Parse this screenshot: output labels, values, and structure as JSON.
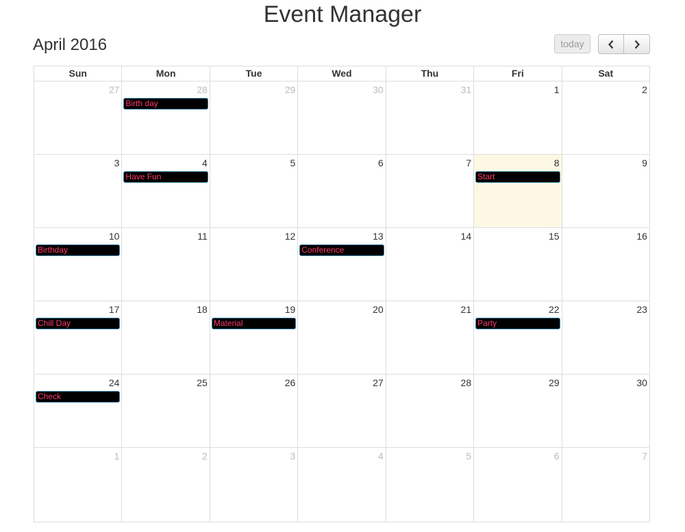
{
  "app": {
    "title": "Event Manager"
  },
  "toolbar": {
    "month_title": "April 2016",
    "today_label": "today",
    "prev_icon": "chevron-left-icon",
    "next_icon": "chevron-right-icon"
  },
  "colors": {
    "event_bg": "#000000",
    "event_text": "#ff3b6b",
    "event_border": "#3a87ad",
    "today_bg": "#fcf8e3",
    "other_month_text": "#bbbbbb",
    "grid": "#dddddd"
  },
  "calendar": {
    "weekdays": [
      "Sun",
      "Mon",
      "Tue",
      "Wed",
      "Thu",
      "Fri",
      "Sat"
    ],
    "weeks": [
      [
        {
          "day": "27",
          "other": true
        },
        {
          "day": "28",
          "other": true,
          "event": "Birth day"
        },
        {
          "day": "29",
          "other": true
        },
        {
          "day": "30",
          "other": true
        },
        {
          "day": "31",
          "other": true
        },
        {
          "day": "1"
        },
        {
          "day": "2"
        }
      ],
      [
        {
          "day": "3"
        },
        {
          "day": "4",
          "event": "Have Fun"
        },
        {
          "day": "5"
        },
        {
          "day": "6"
        },
        {
          "day": "7"
        },
        {
          "day": "8",
          "today": true,
          "event": "Start"
        },
        {
          "day": "9"
        }
      ],
      [
        {
          "day": "10",
          "event": "Birthday"
        },
        {
          "day": "11"
        },
        {
          "day": "12"
        },
        {
          "day": "13",
          "event": "Conference"
        },
        {
          "day": "14"
        },
        {
          "day": "15"
        },
        {
          "day": "16"
        }
      ],
      [
        {
          "day": "17",
          "event": "Chill Day"
        },
        {
          "day": "18"
        },
        {
          "day": "19",
          "event": "Material"
        },
        {
          "day": "20"
        },
        {
          "day": "21"
        },
        {
          "day": "22",
          "event": "Party"
        },
        {
          "day": "23"
        }
      ],
      [
        {
          "day": "24",
          "event": "Check"
        },
        {
          "day": "25"
        },
        {
          "day": "26"
        },
        {
          "day": "27"
        },
        {
          "day": "28"
        },
        {
          "day": "29"
        },
        {
          "day": "30"
        }
      ],
      [
        {
          "day": "1",
          "other": true
        },
        {
          "day": "2",
          "other": true
        },
        {
          "day": "3",
          "other": true
        },
        {
          "day": "4",
          "other": true
        },
        {
          "day": "5",
          "other": true
        },
        {
          "day": "6",
          "other": true
        },
        {
          "day": "7",
          "other": true
        }
      ]
    ]
  }
}
